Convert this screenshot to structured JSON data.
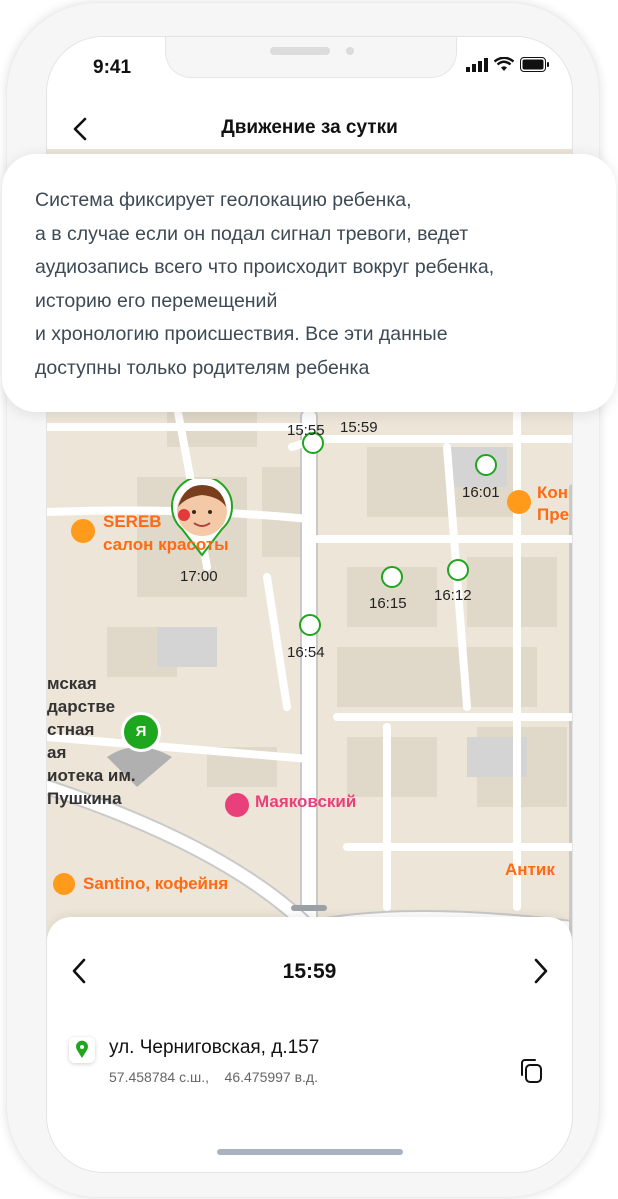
{
  "status_bar": {
    "time": "9:41"
  },
  "header": {
    "title": "Движение за сутки"
  },
  "callout": {
    "lines": [
      "Система фиксирует геолокацию ребенка,",
      "а в случае если он подал сигнал тревоги, ведет",
      "аудиозапись всего что происходит вокруг ребенка,",
      "историю его перемещений",
      "и хронологию происшествия. Все эти данные",
      "доступны только родителям ребенка"
    ]
  },
  "map": {
    "timestamps": [
      "15:55",
      "15:59",
      "16:01",
      "16:12",
      "16:15",
      "16:54",
      "17:00"
    ],
    "pois": [
      {
        "name": "SEREB",
        "color": "#ff6a13"
      },
      {
        "name": "салон красоты",
        "color": "#ff6a13"
      },
      {
        "name": "Маяковский",
        "color": "#e9407c"
      },
      {
        "name": "Santino, кофейня",
        "color": "#ff6a13"
      },
      {
        "name": "Кон",
        "color": "#ff6a13"
      },
      {
        "name": "Пре",
        "color": "#ff6a13"
      },
      {
        "name": "Антик",
        "color": "#ff6a13"
      }
    ],
    "library_lines": [
      "мская",
      "дарстве",
      "стная",
      "ая",
      "иотека им.",
      "Пушкина"
    ],
    "self_marker_label": "Я",
    "accent_color": "#1fa61f"
  },
  "bottom_sheet": {
    "time": "15:59",
    "address": "ул. Черниговская, д.157",
    "lat": "57.458784 с.ш.,",
    "lon": "46.475997 в.д."
  }
}
